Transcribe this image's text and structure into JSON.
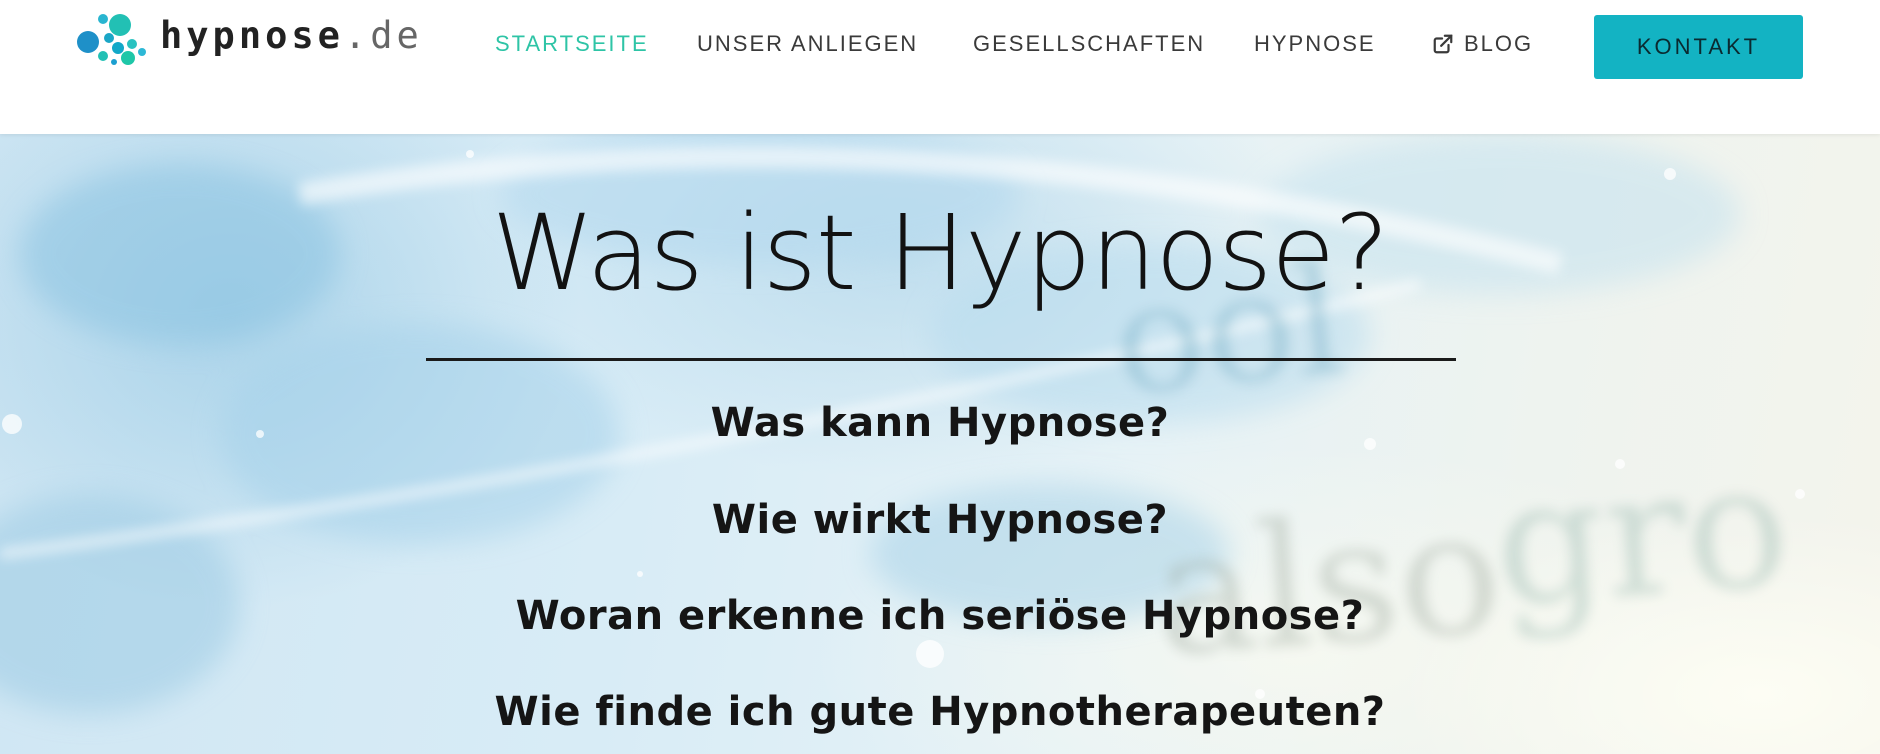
{
  "header": {
    "logo": {
      "name": "hypnose",
      "tld": ".de",
      "icon": "bubble-dots-logo-icon"
    },
    "nav": [
      {
        "label": "STARTSEITE",
        "active": true
      },
      {
        "label": "UNSER ANLIEGEN",
        "active": false
      },
      {
        "label": "GESELLSCHAFTEN",
        "active": false
      },
      {
        "label": "HYPNOSE",
        "active": false
      },
      {
        "label": "BLOG",
        "active": false,
        "icon": "external-link-icon"
      }
    ],
    "contact_button": "KONTAKT"
  },
  "hero": {
    "title": "Was ist Hypnose?",
    "links": [
      "Was kann Hypnose?",
      "Wie wirkt Hypnose?",
      "Woran erkenne ich seriöse Hypnose?",
      "Wie finde ich gute Hypnotherapeuten?"
    ]
  },
  "colors": {
    "accent_green": "#2ec4a6",
    "button_teal": "#13b3c3",
    "text_dark": "#151515"
  }
}
